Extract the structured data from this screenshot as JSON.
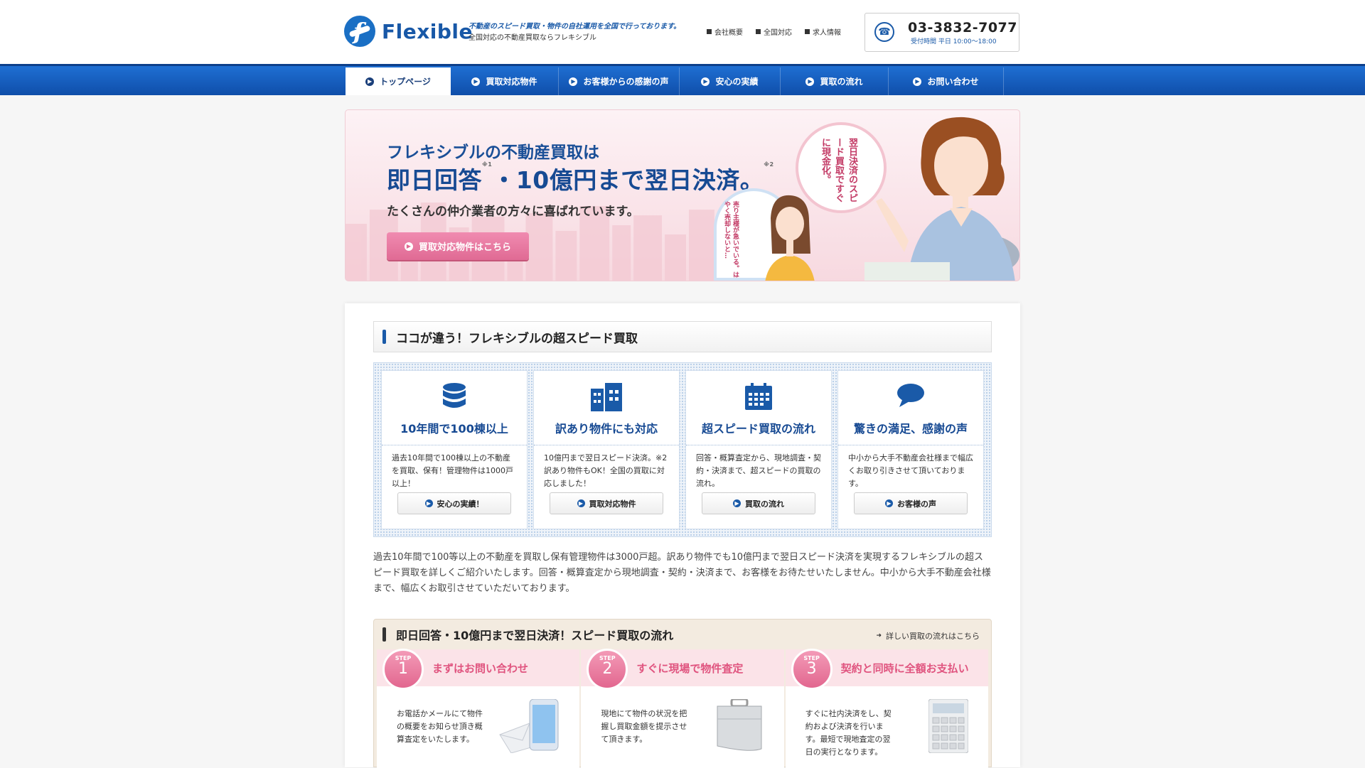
{
  "header": {
    "logo_text": "Flexible",
    "tagline_1": "不動産のスピード買取・物件の自社運用を全国で行っております。",
    "tagline_2": "全国対応の不動産買取ならフレキシブル",
    "util_nav": [
      "会社概要",
      "全国対応",
      "求人情報"
    ],
    "phone_number": "03-3832-7077",
    "phone_hours": "受付時間 平日 10:00～18:00"
  },
  "global_nav": {
    "items": [
      "トップページ",
      "買取対応物件",
      "お客様からの感謝の声",
      "安心の実績",
      "買取の流れ",
      "お問い合わせ"
    ],
    "active_index": 0
  },
  "hero": {
    "line1": "フレキシブルの不動産買取は",
    "line2_a": "即日回答",
    "note1": "※1",
    "line2_b": "・10億円まで翌日決済。",
    "note2": "※2",
    "line3": "たくさんの仲介業者の方々に喜ばれています。",
    "cta_label": "買取対応物件はこちら",
    "bubble_big": "翌日決済のスピード買取ですぐに現金化。",
    "bubble_small": "売り主様が急いでいる。はやく売却しないと…"
  },
  "features_section": {
    "title": "ココが違う！フレキシブルの超スピード買取",
    "items": [
      {
        "icon": "database-icon",
        "title": "10年間で100棟以上",
        "desc": "過去10年間で100棟以上の不動産を買取、保有！管理物件は1000戸以上！",
        "button": "安心の実績！"
      },
      {
        "icon": "building-icon",
        "title": "訳あり物件にも対応",
        "desc": "10億円まで翌日スピード決済。※2訳あり物件もOK！全国の買取に対応しました！",
        "button": "買取対応物件"
      },
      {
        "icon": "calendar-icon",
        "title": "超スピード買取の流れ",
        "desc": "回答・概算査定から、現地調査・契約・決済まで、超スピードの買取の流れ。",
        "button": "買取の流れ"
      },
      {
        "icon": "chat-icon",
        "title": "驚きの満足、感謝の声",
        "desc": "中小から大手不動産会社様まで幅広くお取り引きさせて頂いております。",
        "button": "お客様の声"
      }
    ],
    "intro": "過去10年間で100等以上の不動産を買取し保有管理物件は3000戸超。訳あり物件でも10億円まで翌日スピード決済を実現するフレキシブルの超スピード買取を詳しくご紹介いたします。回答・概算査定から現地調査・契約・決済まで、お客様をお待たせいたしません。中小から大手不動産会社様まで、幅広くお取引させていただいております。"
  },
  "flow_section": {
    "title": "即日回答・10億円まで翌日決済！スピード買取の流れ",
    "link": "詳しい買取の流れはこちら",
    "steps": [
      {
        "label": "STEP",
        "num": "1",
        "title": "まずはお問い合わせ",
        "desc": "お電話かメールにて物件の概要をお知らせ頂き概算査定をいたします。"
      },
      {
        "label": "STEP",
        "num": "2",
        "title": "すぐに現場で物件査定",
        "desc": "現地にて物件の状況を把握し買取金額を提示させて頂きます。"
      },
      {
        "label": "STEP",
        "num": "3",
        "title": "契約と同時に全額お支払い",
        "desc": "すぐに社内決済をし、契約および決済を行います。最短で現地査定の翌日の実行となります。"
      }
    ]
  },
  "colors": {
    "brand_blue": "#1a5aa8",
    "nav_blue": "#1560c2",
    "pink_accent": "#e0547f"
  }
}
